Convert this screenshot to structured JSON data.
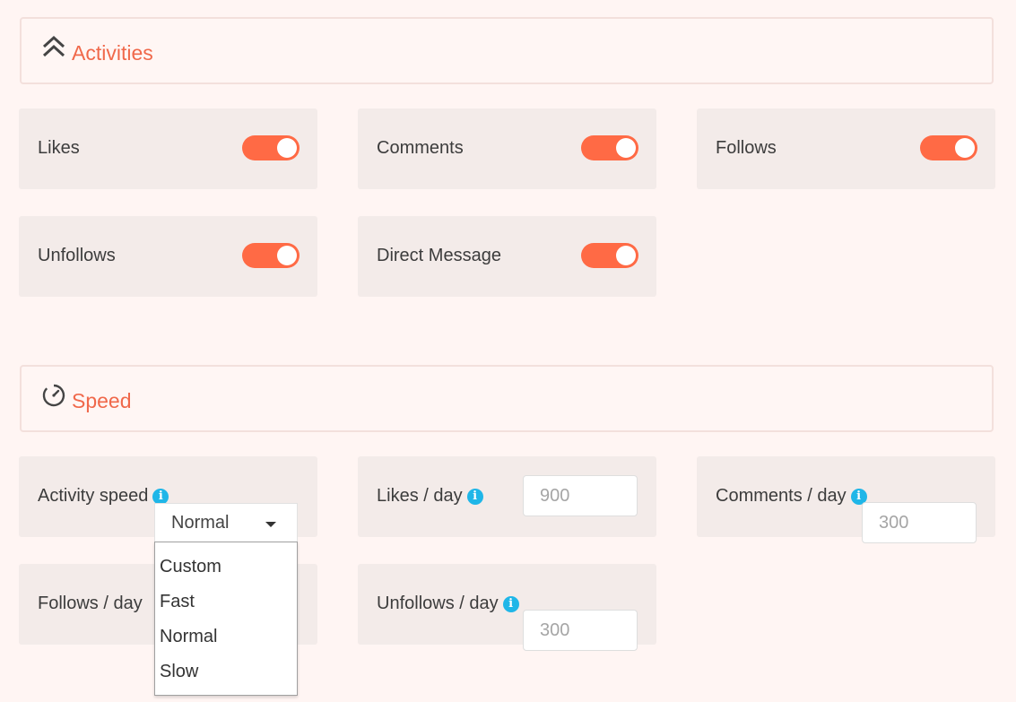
{
  "activities": {
    "title": "Activities",
    "icon": "double-chevron-up-icon",
    "items": [
      {
        "label": "Likes",
        "enabled": true
      },
      {
        "label": "Comments",
        "enabled": true
      },
      {
        "label": "Follows",
        "enabled": true
      },
      {
        "label": "Unfollows",
        "enabled": true
      },
      {
        "label": "Direct Message",
        "enabled": true
      }
    ]
  },
  "speed": {
    "title": "Speed",
    "icon": "speedometer-icon",
    "activity_speed": {
      "label": "Activity speed",
      "selected": "Normal",
      "options": [
        "Custom",
        "Fast",
        "Normal",
        "Slow"
      ]
    },
    "likes_per_day": {
      "label": "Likes / day",
      "value": "900"
    },
    "comments_per_day": {
      "label": "Comments / day",
      "value": "300"
    },
    "follows_per_day": {
      "label": "Follows / day"
    },
    "unfollows_per_day": {
      "label": "Unfollows / day",
      "value": "300"
    }
  },
  "colors": {
    "accent": "#f0684a",
    "toggle_on": "#ff6a45",
    "info": "#1fb6e8",
    "card_bg": "#f3ebe9",
    "page_bg": "#fff5f3"
  }
}
